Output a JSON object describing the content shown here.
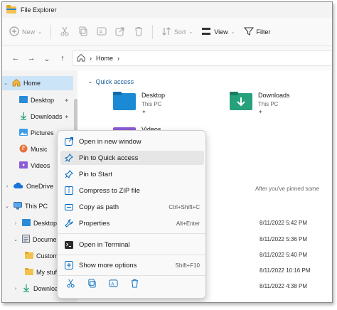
{
  "window": {
    "title": "File Explorer"
  },
  "toolbar": {
    "new_label": "New",
    "sort_label": "Sort",
    "view_label": "View",
    "filter_label": "Filter"
  },
  "address": {
    "breadcrumb": "Home",
    "separator": "›"
  },
  "sidebar": {
    "items": [
      {
        "label": "Home"
      },
      {
        "label": "Desktop"
      },
      {
        "label": "Downloads"
      },
      {
        "label": "Pictures"
      },
      {
        "label": "Music"
      },
      {
        "label": "Videos"
      },
      {
        "label": "OneDrive"
      },
      {
        "label": "This PC"
      },
      {
        "label": "Desktop"
      },
      {
        "label": "Documents"
      },
      {
        "label": "Custom"
      },
      {
        "label": "My stuff"
      },
      {
        "label": "Downloads"
      }
    ]
  },
  "main": {
    "section_title": "Quick access",
    "tiles": [
      {
        "name": "Desktop",
        "location": "This PC"
      },
      {
        "name": "Downloads",
        "location": "This PC"
      },
      {
        "name": "Videos",
        "location": ""
      }
    ],
    "after_pinned_text": "After you've pinned some",
    "dates": [
      "8/11/2022 5:42 PM",
      "8/11/2022 5:36 PM",
      "8/11/2022 5:40 PM",
      "8/11/2022 10:16 PM",
      "8/11/2022 4:38 PM"
    ]
  },
  "context_menu": {
    "items": [
      {
        "label": "Open in new window",
        "shortcut": ""
      },
      {
        "label": "Pin to Quick access",
        "shortcut": ""
      },
      {
        "label": "Pin to Start",
        "shortcut": ""
      },
      {
        "label": "Compress to ZIP file",
        "shortcut": ""
      },
      {
        "label": "Copy as path",
        "shortcut": "Ctrl+Shift+C"
      },
      {
        "label": "Properties",
        "shortcut": "Alt+Enter"
      },
      {
        "label": "Open in Terminal",
        "shortcut": ""
      },
      {
        "label": "Show more options",
        "shortcut": "Shift+F10"
      }
    ]
  },
  "colors": {
    "accent": "#0067c0",
    "folder": "#1a8ad4",
    "downloads_folder": "#26a17b",
    "selection": "#cce4f7"
  }
}
